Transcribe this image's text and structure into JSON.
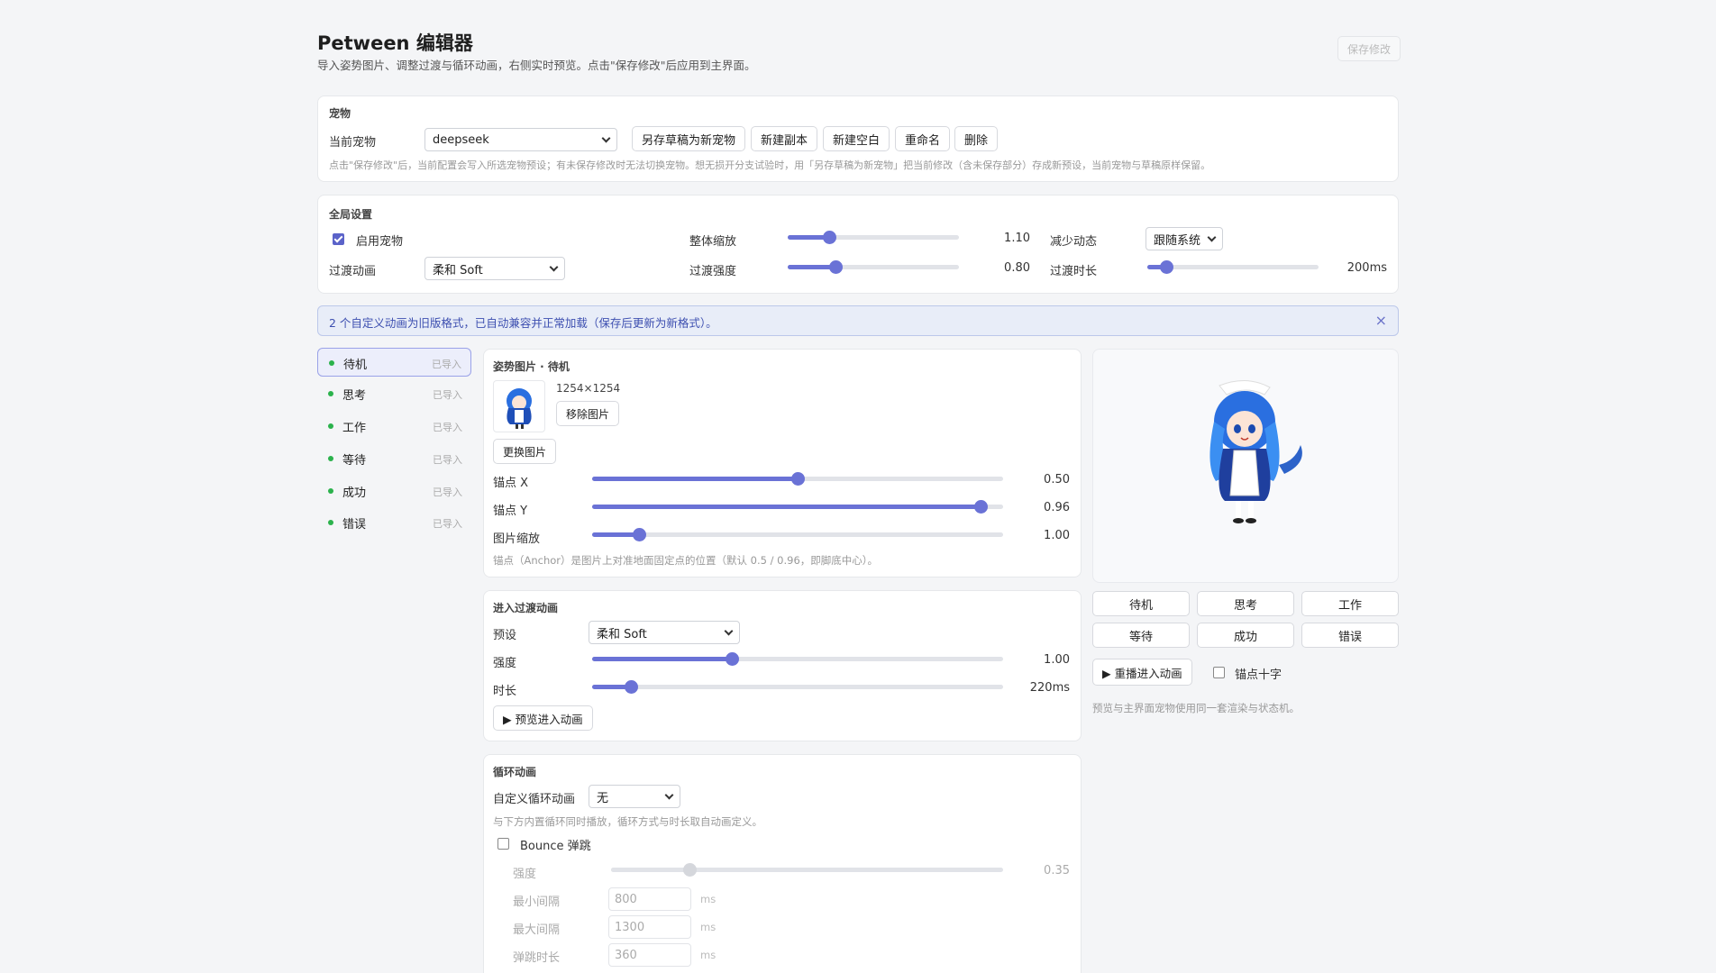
{
  "header": {
    "title": "Petween 编辑器",
    "subtitle": "导入姿势图片、调整过渡与循环动画，右侧实时预览。点击\"保存修改\"后应用到主界面。",
    "save_label": "保存修改"
  },
  "pet": {
    "section_title": "宠物",
    "current_label": "当前宠物",
    "current_value": "deepseek",
    "buttons": {
      "save_draft_as_new": "另存草稿为新宠物",
      "duplicate": "新建副本",
      "new_blank": "新建空白",
      "rename": "重命名",
      "delete": "删除"
    },
    "hint": "点击\"保存修改\"后，当前配置会写入所选宠物预设；有未保存修改时无法切换宠物。想无损开分支试验时，用「另存草稿为新宠物」把当前修改（含未保存部分）存成新预设，当前宠物与草稿原样保留。"
  },
  "global": {
    "section_title": "全局设置",
    "enable_label": "启用宠物",
    "transition_label": "过渡动画",
    "transition_value": "柔和 Soft",
    "scale_label": "整体缩放",
    "scale_value": "1.10",
    "scale_fraction": 0.24,
    "strength_label": "过渡强度",
    "strength_value": "0.80",
    "strength_fraction": 0.28,
    "reduce_motion_label": "减少动态",
    "reduce_motion_value": "跟随系统",
    "duration_label": "过渡时长",
    "duration_value": "200ms",
    "duration_fraction": 0.11
  },
  "alert": {
    "text": "2 个自定义动画为旧版格式，已自动兼容并正常加载（保存后更新为新格式）。",
    "close": "×"
  },
  "states": [
    {
      "name": "待机",
      "tag": "已导入"
    },
    {
      "name": "思考",
      "tag": "已导入"
    },
    {
      "name": "工作",
      "tag": "已导入"
    },
    {
      "name": "等待",
      "tag": "已导入"
    },
    {
      "name": "成功",
      "tag": "已导入"
    },
    {
      "name": "错误",
      "tag": "已导入"
    }
  ],
  "pose": {
    "section_title": "姿势图片 · 待机",
    "image_size": "1254×1254",
    "remove_label": "移除图片",
    "replace_label": "更换图片",
    "anchor_x_label": "锚点 X",
    "anchor_x_value": "0.50",
    "anchor_x_fraction": 0.5,
    "anchor_y_label": "锚点 Y",
    "anchor_y_value": "0.96",
    "anchor_y_fraction": 0.946,
    "scale_label": "图片缩放",
    "scale_value": "1.00",
    "scale_fraction": 0.115,
    "hint": "锚点（Anchor）是图片上对准地面固定点的位置（默认 0.5 / 0.96，即脚底中心）。"
  },
  "enter": {
    "section_title": "进入过渡动画",
    "preset_label": "预设",
    "preset_value": "柔和 Soft",
    "strength_label": "强度",
    "strength_value": "1.00",
    "strength_fraction": 0.34,
    "duration_label": "时长",
    "duration_value": "220ms",
    "duration_fraction": 0.095,
    "preview_label": "▶ 预览进入动画"
  },
  "loop": {
    "section_title": "循环动画",
    "custom_label": "自定义循环动画",
    "custom_value": "无",
    "hint": "与下方内置循环同时播放，循环方式与时长取自动画定义。",
    "bounce_label": "Bounce 弹跳",
    "bounce_strength_label": "强度",
    "bounce_strength_value": "0.35",
    "bounce_strength_fraction": 0.2,
    "min_interval_label": "最小间隔",
    "min_interval_value": "800",
    "max_interval_label": "最大间隔",
    "max_interval_value": "1300",
    "bounce_duration_label": "弹跳时长",
    "bounce_duration_value": "360",
    "unit": "ms"
  },
  "preview": {
    "state_buttons": [
      "待机",
      "思考",
      "工作",
      "等待",
      "成功",
      "错误"
    ],
    "replay_label": "▶ 重播进入动画",
    "crosshair_label": "锚点十字",
    "hint": "预览与主界面宠物使用同一套渲染与状态机。"
  },
  "colors": {
    "accent": "#6a72d6",
    "status_green": "#2bb24c",
    "alert_bg": "#e8edf8"
  }
}
